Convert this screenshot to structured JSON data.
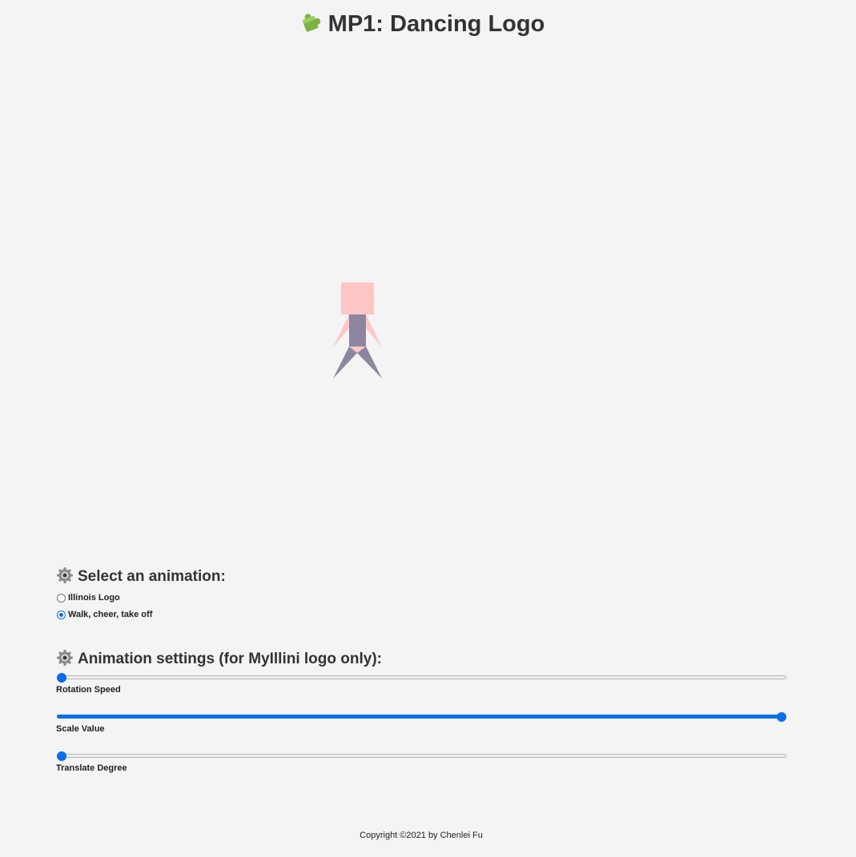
{
  "header": {
    "title_icon": "puzzle-piece-icon",
    "title": "MP1: Dancing Logo"
  },
  "canvas": {
    "figure_head_color": "#ffc6c6",
    "figure_body_color": "#8c86a0"
  },
  "animation_select": {
    "heading_icon": "gear-icon",
    "heading": "Select an animation:",
    "options": [
      {
        "label": "Illinois Logo",
        "checked": false
      },
      {
        "label": "Walk, cheer, take off",
        "checked": true
      }
    ]
  },
  "animation_settings": {
    "heading_icon": "gear-icon",
    "heading": "Animation settings (for MyIllini logo only):",
    "sliders": [
      {
        "label": "Rotation Speed",
        "value_fraction": 0.0
      },
      {
        "label": "Scale Value",
        "value_fraction": 1.0
      },
      {
        "label": "Translate Degree",
        "value_fraction": 0.0
      }
    ]
  },
  "footer": {
    "copyright": "Copyright ©2021 by Chenlei Fu"
  },
  "colors": {
    "accent": "#0b6ee8",
    "background": "#f4f4f4",
    "text": "#333333"
  }
}
